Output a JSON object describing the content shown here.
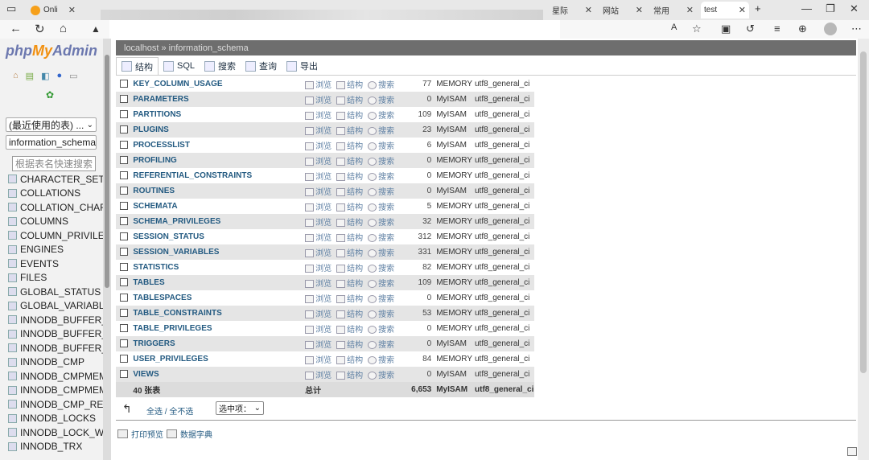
{
  "browser": {
    "tabs": [
      {
        "label": "Onli",
        "active": false
      },
      {
        "label": "星际",
        "active": false
      },
      {
        "label": "网站",
        "active": false
      },
      {
        "label": "常用",
        "active": false
      },
      {
        "label": "test",
        "active": true
      }
    ],
    "address_warning": "▲"
  },
  "sidebar": {
    "logo_php": "php",
    "logo_my": "My",
    "logo_admin": "Admin",
    "recent_select": "(最近使用的表) ...",
    "db_select": "information_schema",
    "filter_placeholder": "根据表名快速搜索",
    "tables": [
      "CHARACTER_SETS",
      "COLLATIONS",
      "COLLATION_CHARA",
      "COLUMNS",
      "COLUMN_PRIVILEG",
      "ENGINES",
      "EVENTS",
      "FILES",
      "GLOBAL_STATUS",
      "GLOBAL_VARIABLES",
      "INNODB_BUFFER_P",
      "INNODB_BUFFER_P",
      "INNODB_BUFFER_P",
      "INNODB_CMP",
      "INNODB_CMPMEM",
      "INNODB_CMPMEM",
      "INNODB_CMP_RESI",
      "INNODB_LOCKS",
      "INNODB_LOCK_WA",
      "INNODB_TRX"
    ]
  },
  "main": {
    "breadcrumb": "localhost » information_schema",
    "tabs": [
      "结构",
      "SQL",
      "搜索",
      "查询",
      "导出"
    ],
    "actions": {
      "browse": "浏览",
      "structure": "结构",
      "search": "搜索"
    },
    "rows": [
      {
        "name": "KEY_COLUMN_USAGE",
        "rows": "77",
        "engine": "MEMORY",
        "collation": "utf8_general_ci"
      },
      {
        "name": "PARAMETERS",
        "rows": "0",
        "engine": "MyISAM",
        "collation": "utf8_general_ci"
      },
      {
        "name": "PARTITIONS",
        "rows": "109",
        "engine": "MyISAM",
        "collation": "utf8_general_ci"
      },
      {
        "name": "PLUGINS",
        "rows": "23",
        "engine": "MyISAM",
        "collation": "utf8_general_ci"
      },
      {
        "name": "PROCESSLIST",
        "rows": "6",
        "engine": "MyISAM",
        "collation": "utf8_general_ci"
      },
      {
        "name": "PROFILING",
        "rows": "0",
        "engine": "MEMORY",
        "collation": "utf8_general_ci"
      },
      {
        "name": "REFERENTIAL_CONSTRAINTS",
        "rows": "0",
        "engine": "MEMORY",
        "collation": "utf8_general_ci"
      },
      {
        "name": "ROUTINES",
        "rows": "0",
        "engine": "MyISAM",
        "collation": "utf8_general_ci"
      },
      {
        "name": "SCHEMATA",
        "rows": "5",
        "engine": "MEMORY",
        "collation": "utf8_general_ci"
      },
      {
        "name": "SCHEMA_PRIVILEGES",
        "rows": "32",
        "engine": "MEMORY",
        "collation": "utf8_general_ci"
      },
      {
        "name": "SESSION_STATUS",
        "rows": "312",
        "engine": "MEMORY",
        "collation": "utf8_general_ci"
      },
      {
        "name": "SESSION_VARIABLES",
        "rows": "331",
        "engine": "MEMORY",
        "collation": "utf8_general_ci"
      },
      {
        "name": "STATISTICS",
        "rows": "82",
        "engine": "MEMORY",
        "collation": "utf8_general_ci"
      },
      {
        "name": "TABLES",
        "rows": "109",
        "engine": "MEMORY",
        "collation": "utf8_general_ci"
      },
      {
        "name": "TABLESPACES",
        "rows": "0",
        "engine": "MEMORY",
        "collation": "utf8_general_ci"
      },
      {
        "name": "TABLE_CONSTRAINTS",
        "rows": "53",
        "engine": "MEMORY",
        "collation": "utf8_general_ci"
      },
      {
        "name": "TABLE_PRIVILEGES",
        "rows": "0",
        "engine": "MEMORY",
        "collation": "utf8_general_ci"
      },
      {
        "name": "TRIGGERS",
        "rows": "0",
        "engine": "MyISAM",
        "collation": "utf8_general_ci"
      },
      {
        "name": "USER_PRIVILEGES",
        "rows": "84",
        "engine": "MEMORY",
        "collation": "utf8_general_ci"
      },
      {
        "name": "VIEWS",
        "rows": "0",
        "engine": "MyISAM",
        "collation": "utf8_general_ci"
      }
    ],
    "total": {
      "name": "40 张表",
      "label": "总计",
      "rows": "6,653",
      "engine": "MyISAM",
      "collation": "utf8_general_ci"
    },
    "select_all": "全选 / 全不选",
    "with_selected": "选中项：",
    "print_view": "打印预览",
    "data_dict": "数据字典"
  }
}
